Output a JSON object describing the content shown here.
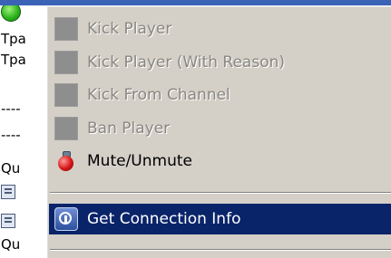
{
  "background_list": {
    "rows": [
      {
        "text": "Tpa"
      },
      {
        "text": "Tpa"
      },
      {
        "text": "----"
      },
      {
        "text": "----"
      },
      {
        "text": "Qu"
      },
      {
        "text": ""
      },
      {
        "text": ""
      },
      {
        "text": "Qu"
      }
    ]
  },
  "context_menu": {
    "items": [
      {
        "label": "Kick Player",
        "enabled": false,
        "icon": "placeholder-icon"
      },
      {
        "label": "Kick Player (With Reason)",
        "enabled": false,
        "icon": "placeholder-icon"
      },
      {
        "label": "Kick From Channel",
        "enabled": false,
        "icon": "placeholder-icon"
      },
      {
        "label": "Ban Player",
        "enabled": false,
        "icon": "placeholder-icon"
      },
      {
        "label": "Mute/Unmute",
        "enabled": true,
        "icon": "mute-bomb-icon"
      },
      {
        "label": "Get Connection Info",
        "enabled": true,
        "highlighted": true,
        "icon": "connection-info-icon"
      }
    ]
  },
  "colors": {
    "menu_background": "#d4d0c8",
    "highlight": "#0a246a",
    "disabled_text": "#8a8780",
    "title_strip": "#3a63b8"
  }
}
